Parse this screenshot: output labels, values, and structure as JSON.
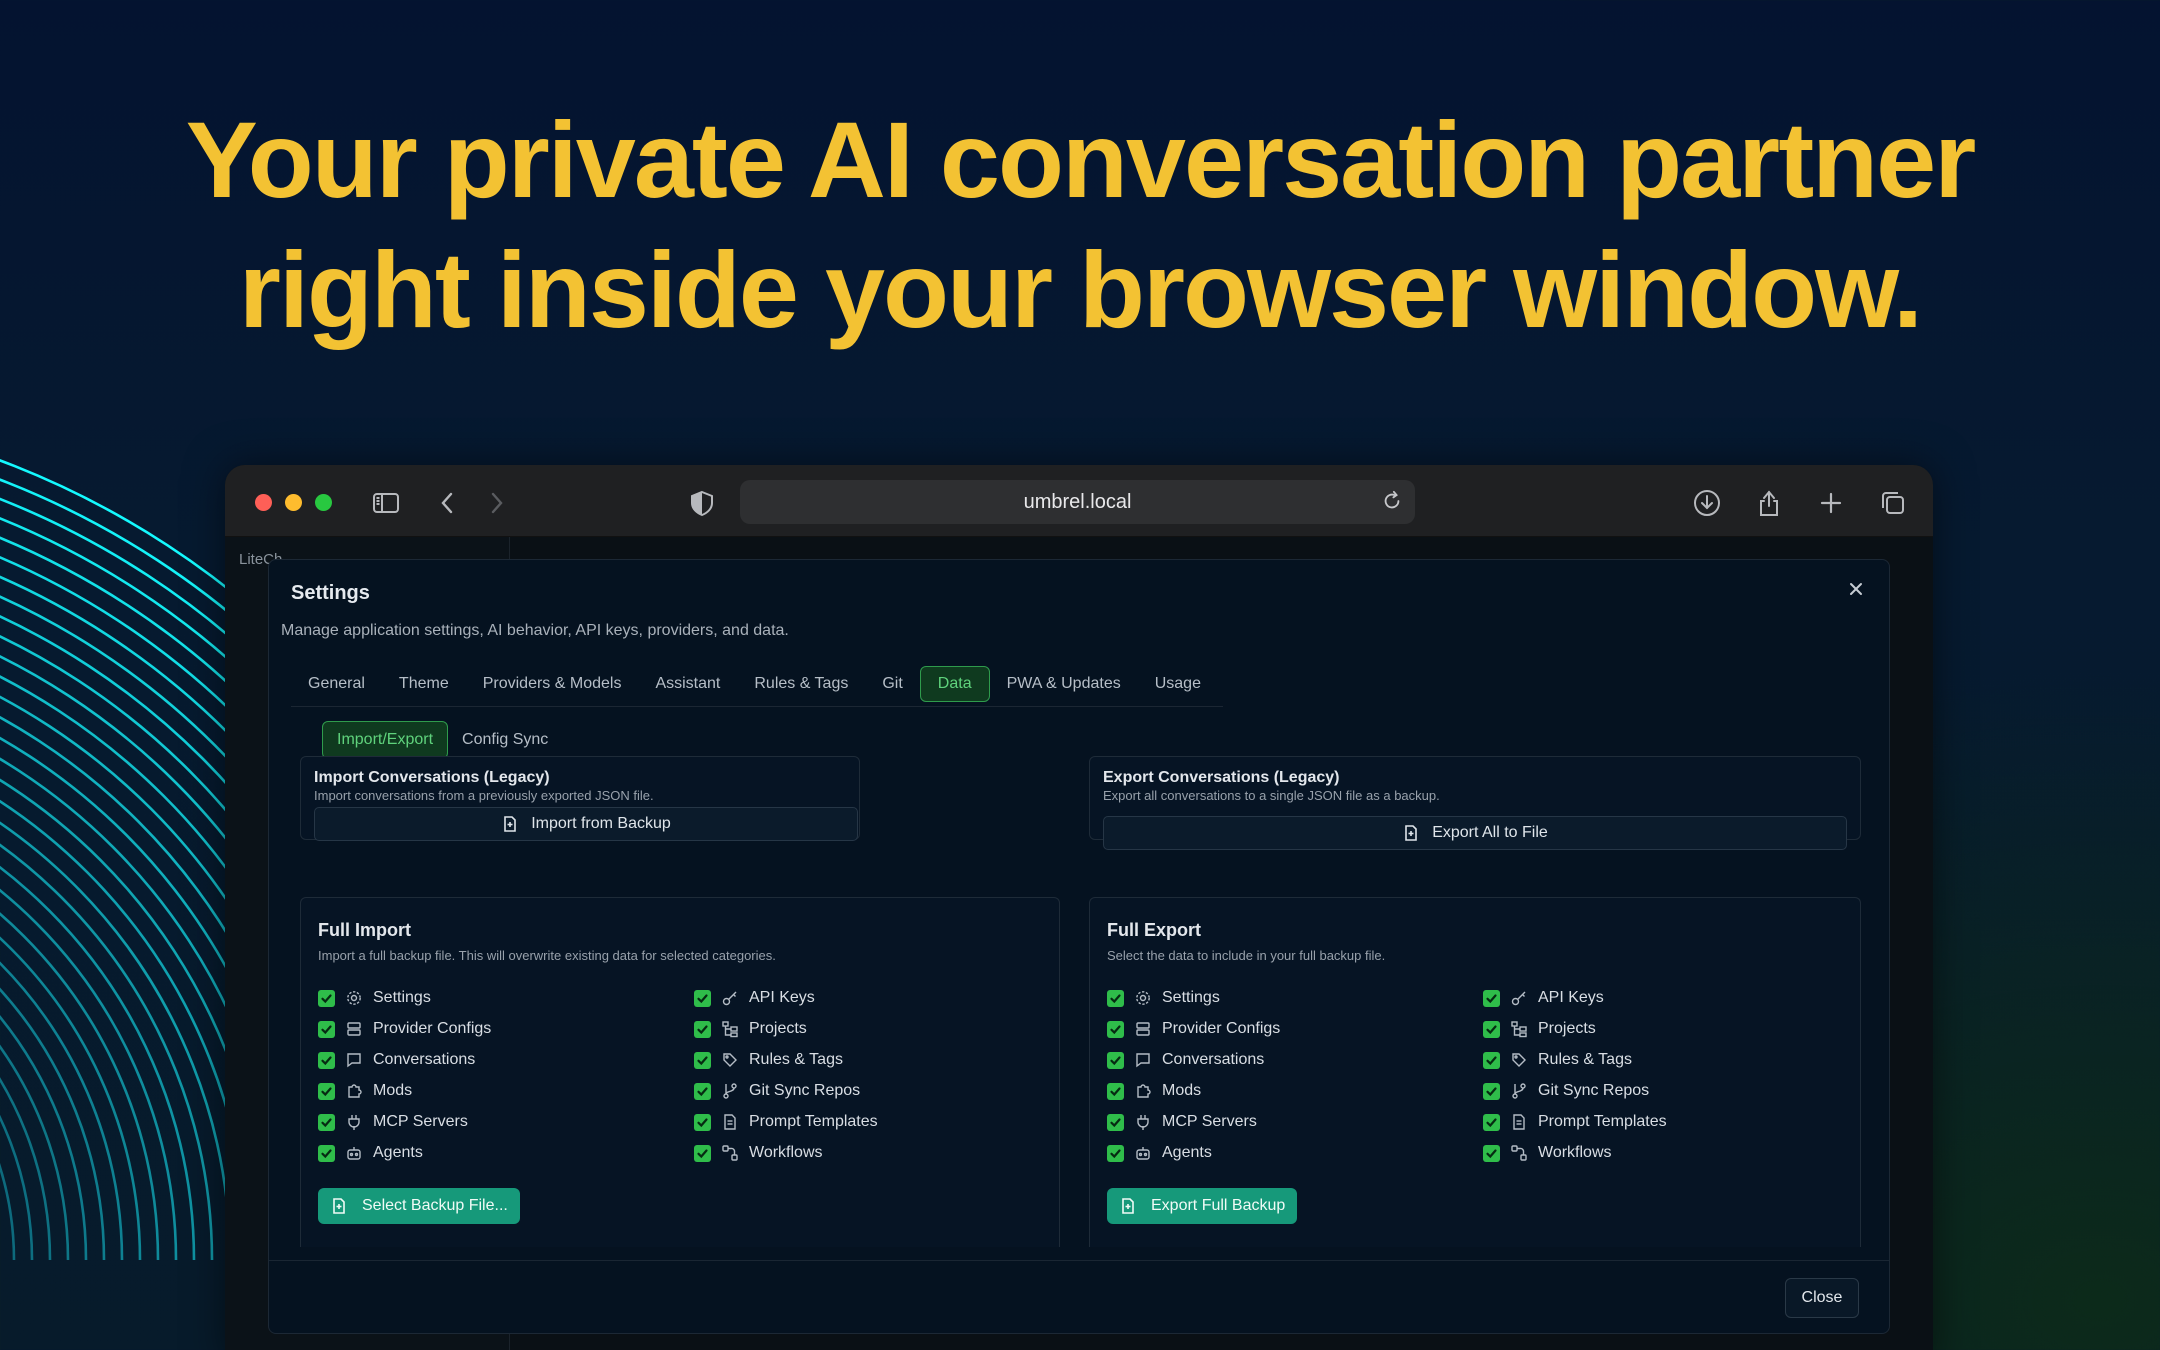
{
  "hero": {
    "line1": "Your private AI conversation partner",
    "line2": "right inside your browser window."
  },
  "browser": {
    "url": "umbrel.local",
    "app_name": "LiteCh"
  },
  "settings": {
    "title": "Settings",
    "subtitle": "Manage application settings, AI behavior, API keys, providers, and data.",
    "tabs": [
      {
        "label": "General"
      },
      {
        "label": "Theme"
      },
      {
        "label": "Providers & Models"
      },
      {
        "label": "Assistant"
      },
      {
        "label": "Rules & Tags"
      },
      {
        "label": "Git"
      },
      {
        "label": "Data",
        "active": true
      },
      {
        "label": "PWA & Updates"
      },
      {
        "label": "Usage"
      }
    ],
    "subtabs": [
      {
        "label": "Import/Export",
        "active": true
      },
      {
        "label": "Config Sync"
      }
    ],
    "legacy_import": {
      "title": "Import Conversations (Legacy)",
      "desc": "Import conversations from a previously exported JSON file.",
      "button": "Import from Backup"
    },
    "legacy_export": {
      "title": "Export Conversations (Legacy)",
      "desc": "Export all conversations to a single JSON file as a backup.",
      "button": "Export All to File"
    },
    "full_import": {
      "title": "Full Import",
      "desc": "Import a full backup file. This will overwrite existing data for selected categories.",
      "button": "Select Backup File...",
      "items": [
        {
          "label": "Settings",
          "icon": "gear-icon",
          "checked": true
        },
        {
          "label": "API Keys",
          "icon": "key-icon",
          "checked": true
        },
        {
          "label": "Provider Configs",
          "icon": "server-icon",
          "checked": true
        },
        {
          "label": "Projects",
          "icon": "folder-tree-icon",
          "checked": true
        },
        {
          "label": "Conversations",
          "icon": "message-icon",
          "checked": true
        },
        {
          "label": "Rules & Tags",
          "icon": "tags-icon",
          "checked": true
        },
        {
          "label": "Mods",
          "icon": "puzzle-icon",
          "checked": true
        },
        {
          "label": "Git Sync Repos",
          "icon": "git-branch-icon",
          "checked": true
        },
        {
          "label": "MCP Servers",
          "icon": "plug-icon",
          "checked": true
        },
        {
          "label": "Prompt Templates",
          "icon": "file-text-icon",
          "checked": true
        },
        {
          "label": "Agents",
          "icon": "bot-icon",
          "checked": true
        },
        {
          "label": "Workflows",
          "icon": "workflow-icon",
          "checked": true
        }
      ]
    },
    "full_export": {
      "title": "Full Export",
      "desc": "Select the data to include in your full backup file.",
      "button": "Export Full Backup",
      "items": [
        {
          "label": "Settings",
          "icon": "gear-icon",
          "checked": true
        },
        {
          "label": "API Keys",
          "icon": "key-icon",
          "checked": true
        },
        {
          "label": "Provider Configs",
          "icon": "server-icon",
          "checked": true
        },
        {
          "label": "Projects",
          "icon": "folder-tree-icon",
          "checked": true
        },
        {
          "label": "Conversations",
          "icon": "message-icon",
          "checked": true
        },
        {
          "label": "Rules & Tags",
          "icon": "tags-icon",
          "checked": true
        },
        {
          "label": "Mods",
          "icon": "puzzle-icon",
          "checked": true
        },
        {
          "label": "Git Sync Repos",
          "icon": "git-branch-icon",
          "checked": true
        },
        {
          "label": "MCP Servers",
          "icon": "plug-icon",
          "checked": true
        },
        {
          "label": "Prompt Templates",
          "icon": "file-text-icon",
          "checked": true
        },
        {
          "label": "Agents",
          "icon": "bot-icon",
          "checked": true
        },
        {
          "label": "Workflows",
          "icon": "workflow-icon",
          "checked": true
        }
      ]
    },
    "close_label": "Close"
  },
  "colors": {
    "hero_text": "#f3c233",
    "accent_green": "#2fbd4a",
    "button_teal": "#16997a",
    "background": "#041330"
  }
}
